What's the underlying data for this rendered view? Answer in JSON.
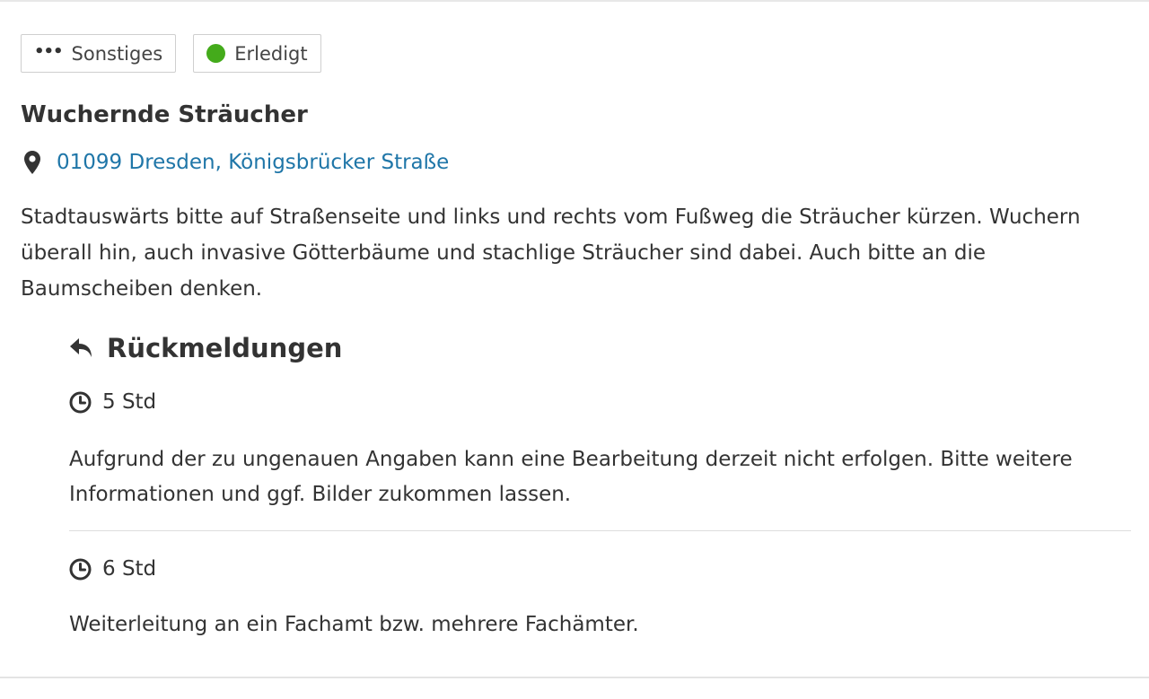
{
  "tags": {
    "category_label": "Sonstiges",
    "status_label": "Erledigt",
    "status_color": "#44ab1b"
  },
  "report": {
    "title": "Wuchernde Sträucher",
    "location": "01099 Dresden, Königsbrücker Straße",
    "description": "Stadtauswärts bitte auf Straßenseite und links und rechts vom Fußweg die Sträucher kürzen. Wuchern überall hin, auch invasive Götterbäume und stachlige Sträucher sind dabei. Auch bitte an die Baumscheiben denken."
  },
  "feedback": {
    "heading": "Rückmeldungen",
    "entries": [
      {
        "time": "5 Std",
        "text": "Aufgrund der zu ungenauen Angaben kann eine Bearbeitung derzeit nicht erfolgen. Bitte weitere Informationen und ggf. Bilder zukommen lassen."
      },
      {
        "time": "6 Std",
        "text": "Weiterleitung an ein Fachamt bzw. mehrere Fachämter."
      }
    ]
  },
  "icons": {
    "category": "more-dots-icon",
    "status": "status-dot-icon",
    "location": "map-marker-icon",
    "feedback": "reply-icon",
    "time": "clock-icon"
  },
  "colors": {
    "link": "#1f76a8",
    "text": "#333333",
    "status_done": "#44ab1b"
  }
}
